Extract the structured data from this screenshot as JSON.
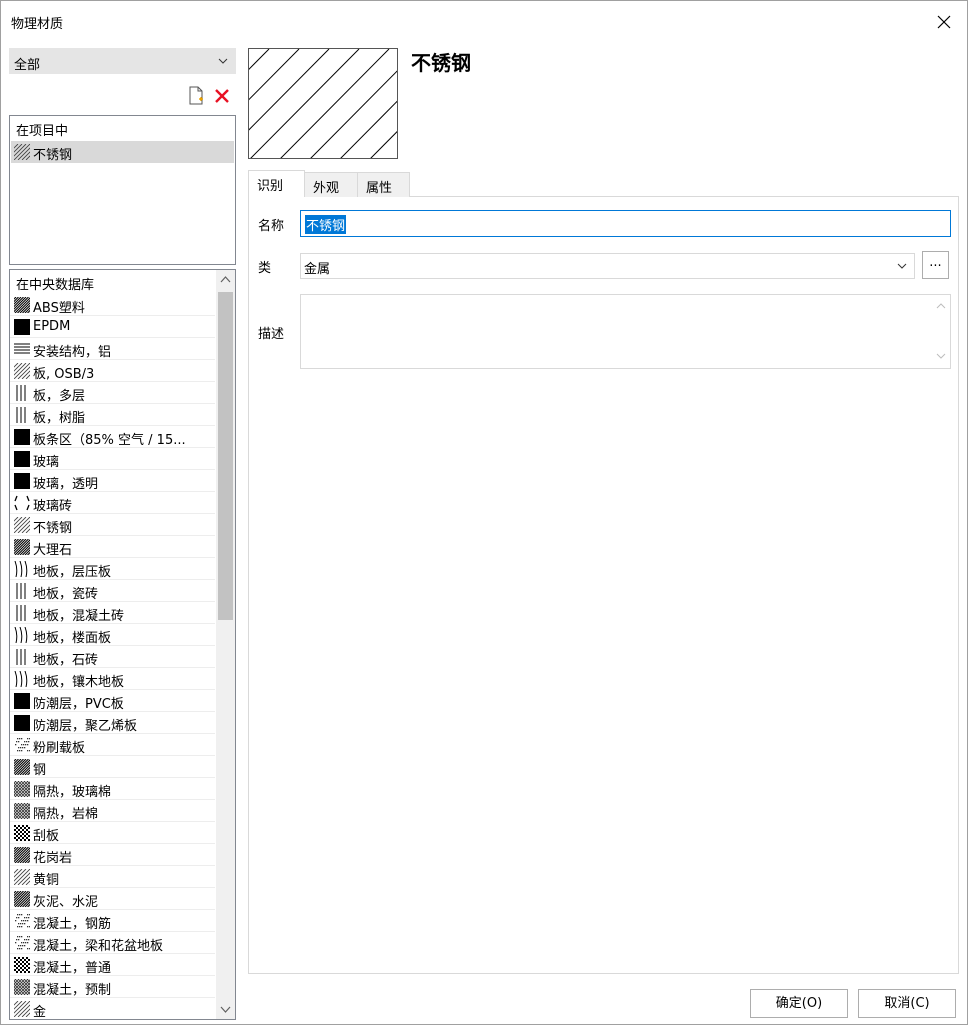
{
  "window": {
    "title": "物理材质"
  },
  "filter": {
    "selected": "全部"
  },
  "project": {
    "header": "在项目中",
    "items": [
      {
        "label": "不锈钢",
        "pattern": "hatch-diagonal"
      }
    ]
  },
  "database": {
    "header": "在中央数据库",
    "items": [
      {
        "label": "ABS塑料",
        "pattern": "hatch-dense"
      },
      {
        "label": "EPDM",
        "pattern": "solid"
      },
      {
        "label": "安装结构，铝",
        "pattern": "horizontal-lines"
      },
      {
        "label": "板, OSB/3",
        "pattern": "hatch-diagonal"
      },
      {
        "label": "板，多层",
        "pattern": "vertical-lines"
      },
      {
        "label": "板，树脂",
        "pattern": "vertical-lines"
      },
      {
        "label": "板条区（85% 空气 / 15...",
        "pattern": "solid"
      },
      {
        "label": "玻璃",
        "pattern": "solid"
      },
      {
        "label": "玻璃，透明",
        "pattern": "solid"
      },
      {
        "label": "玻璃砖",
        "pattern": "brackets"
      },
      {
        "label": "不锈钢",
        "pattern": "hatch-diagonal"
      },
      {
        "label": "大理石",
        "pattern": "hatch-dense"
      },
      {
        "label": "地板，层压板",
        "pattern": "wavy"
      },
      {
        "label": "地板，瓷砖",
        "pattern": "vertical-lines"
      },
      {
        "label": "地板，混凝土砖",
        "pattern": "vertical-lines"
      },
      {
        "label": "地板，楼面板",
        "pattern": "wavy"
      },
      {
        "label": "地板，石砖",
        "pattern": "vertical-lines"
      },
      {
        "label": "地板，镶木地板",
        "pattern": "wavy"
      },
      {
        "label": "防潮层，PVC板",
        "pattern": "solid"
      },
      {
        "label": "防潮层，聚乙烯板",
        "pattern": "solid"
      },
      {
        "label": "粉刷载板",
        "pattern": "dotted"
      },
      {
        "label": "钢",
        "pattern": "hatch-dense"
      },
      {
        "label": "隔热，玻璃棉",
        "pattern": "crosshatch"
      },
      {
        "label": "隔热，岩棉",
        "pattern": "crosshatch"
      },
      {
        "label": "刮板",
        "pattern": "checker"
      },
      {
        "label": "花岗岩",
        "pattern": "hatch-dense"
      },
      {
        "label": "黄铜",
        "pattern": "hatch-diagonal"
      },
      {
        "label": "灰泥、水泥",
        "pattern": "hatch-dense"
      },
      {
        "label": "混凝土，钢筋",
        "pattern": "dotted"
      },
      {
        "label": "混凝土，梁和花盆地板",
        "pattern": "dotted"
      },
      {
        "label": "混凝土，普通",
        "pattern": "checker"
      },
      {
        "label": "混凝土，预制",
        "pattern": "crosshatch"
      },
      {
        "label": "金",
        "pattern": "hatch-diagonal"
      }
    ]
  },
  "material": {
    "title": "不锈钢"
  },
  "tabs": [
    {
      "label": "识别",
      "active": true
    },
    {
      "label": "外观",
      "active": false
    },
    {
      "label": "属性",
      "active": false
    }
  ],
  "form": {
    "name_label": "名称",
    "name_value": "不锈钢",
    "class_label": "类",
    "class_value": "金属",
    "more_label": "...",
    "desc_label": "描述",
    "desc_value": ""
  },
  "buttons": {
    "ok": "确定(O)",
    "cancel": "取消(C)"
  },
  "colors": {
    "selection": "#0078d7",
    "selected_row": "#d9d9d9",
    "delete_red": "#e81123"
  }
}
